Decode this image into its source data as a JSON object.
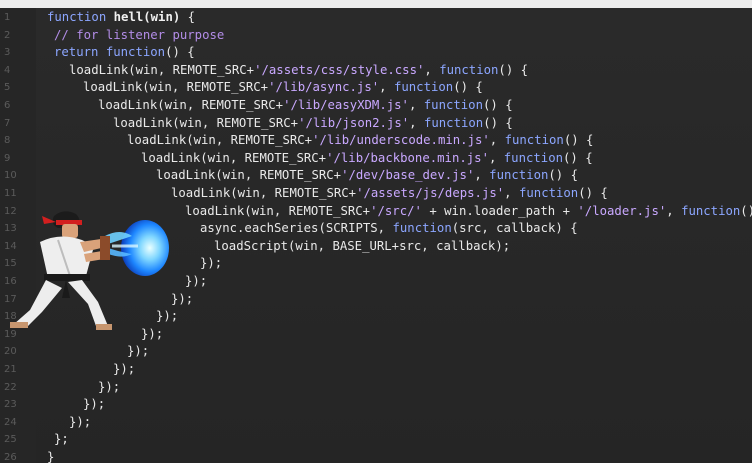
{
  "window": {
    "top_strip_color": "#ececec",
    "background_color": "#262626"
  },
  "colors": {
    "keyword": "#8ca6ff",
    "string": "#c9a8ff",
    "comment": "#b38de8",
    "plain": "#e9e9e9",
    "line_number": "#5b5b5b",
    "hadouken_blue": "#2ea7ff"
  },
  "sprite": {
    "icon": "street-fighter-ryu-hadouken-icon"
  },
  "code": {
    "lines": [
      {
        "number": "1",
        "indent": 11,
        "tokens": [
          {
            "t": "function",
            "c": "kw"
          },
          {
            "t": " ",
            "c": "plain"
          },
          {
            "t": "hell(win)",
            "c": "fnname"
          },
          {
            "t": " {",
            "c": "plain"
          }
        ]
      },
      {
        "number": "2",
        "indent": 18,
        "tokens": [
          {
            "t": "// for listener purpose",
            "c": "cmt"
          }
        ]
      },
      {
        "number": "3",
        "indent": 18,
        "tokens": [
          {
            "t": "return",
            "c": "kw"
          },
          {
            "t": " ",
            "c": "plain"
          },
          {
            "t": "function",
            "c": "kw"
          },
          {
            "t": "() {",
            "c": "plain"
          }
        ]
      },
      {
        "number": "4",
        "indent": 33,
        "tokens": [
          {
            "t": "loadLink(win, REMOTE_SRC+",
            "c": "plain"
          },
          {
            "t": "'/assets/css/style.css'",
            "c": "str"
          },
          {
            "t": ", ",
            "c": "plain"
          },
          {
            "t": "function",
            "c": "kw"
          },
          {
            "t": "() {",
            "c": "plain"
          }
        ]
      },
      {
        "number": "5",
        "indent": 47,
        "tokens": [
          {
            "t": "loadLink(win, REMOTE_SRC+",
            "c": "plain"
          },
          {
            "t": "'/lib/async.js'",
            "c": "str"
          },
          {
            "t": ", ",
            "c": "plain"
          },
          {
            "t": "function",
            "c": "kw"
          },
          {
            "t": "() {",
            "c": "plain"
          }
        ]
      },
      {
        "number": "6",
        "indent": 62,
        "tokens": [
          {
            "t": "loadLink(win, REMOTE_SRC+",
            "c": "plain"
          },
          {
            "t": "'/lib/easyXDM.js'",
            "c": "str"
          },
          {
            "t": ", ",
            "c": "plain"
          },
          {
            "t": "function",
            "c": "kw"
          },
          {
            "t": "() {",
            "c": "plain"
          }
        ]
      },
      {
        "number": "7",
        "indent": 77,
        "tokens": [
          {
            "t": "loadLink(win, REMOTE_SRC+",
            "c": "plain"
          },
          {
            "t": "'/lib/json2.js'",
            "c": "str"
          },
          {
            "t": ", ",
            "c": "plain"
          },
          {
            "t": "function",
            "c": "kw"
          },
          {
            "t": "() {",
            "c": "plain"
          }
        ]
      },
      {
        "number": "8",
        "indent": 91,
        "tokens": [
          {
            "t": "loadLink(win, REMOTE_SRC+",
            "c": "plain"
          },
          {
            "t": "'/lib/underscode.min.js'",
            "c": "str"
          },
          {
            "t": ", ",
            "c": "plain"
          },
          {
            "t": "function",
            "c": "kw"
          },
          {
            "t": "() {",
            "c": "plain"
          }
        ]
      },
      {
        "number": "9",
        "indent": 105,
        "tokens": [
          {
            "t": "loadLink(win, REMOTE_SRC+",
            "c": "plain"
          },
          {
            "t": "'/lib/backbone.min.js'",
            "c": "str"
          },
          {
            "t": ", ",
            "c": "plain"
          },
          {
            "t": "function",
            "c": "kw"
          },
          {
            "t": "() {",
            "c": "plain"
          }
        ]
      },
      {
        "number": "10",
        "indent": 120,
        "tokens": [
          {
            "t": "loadLink(win, REMOTE_SRC+",
            "c": "plain"
          },
          {
            "t": "'/dev/base_dev.js'",
            "c": "str"
          },
          {
            "t": ", ",
            "c": "plain"
          },
          {
            "t": "function",
            "c": "kw"
          },
          {
            "t": "() {",
            "c": "plain"
          }
        ]
      },
      {
        "number": "11",
        "indent": 135,
        "tokens": [
          {
            "t": "loadLink(win, REMOTE_SRC+",
            "c": "plain"
          },
          {
            "t": "'/assets/js/deps.js'",
            "c": "str"
          },
          {
            "t": ", ",
            "c": "plain"
          },
          {
            "t": "function",
            "c": "kw"
          },
          {
            "t": "() {",
            "c": "plain"
          }
        ]
      },
      {
        "number": "12",
        "indent": 149,
        "tokens": [
          {
            "t": "loadLink(win, REMOTE_SRC+",
            "c": "plain"
          },
          {
            "t": "'/src/'",
            "c": "str"
          },
          {
            "t": " + win.loader_path + ",
            "c": "plain"
          },
          {
            "t": "'/loader.js'",
            "c": "str"
          },
          {
            "t": ", ",
            "c": "plain"
          },
          {
            "t": "function",
            "c": "kw"
          },
          {
            "t": "()",
            "c": "plain"
          }
        ]
      },
      {
        "number": "13",
        "indent": 164,
        "tokens": [
          {
            "t": "async.eachSeries(SCRIPTS, ",
            "c": "plain"
          },
          {
            "t": "function",
            "c": "kw"
          },
          {
            "t": "(src, callback) {",
            "c": "plain"
          }
        ]
      },
      {
        "number": "14",
        "indent": 178,
        "tokens": [
          {
            "t": "loadScript(win, BASE_URL+src, callback);",
            "c": "plain"
          }
        ]
      },
      {
        "number": "15",
        "indent": 164,
        "tokens": [
          {
            "t": "});",
            "c": "plain"
          }
        ]
      },
      {
        "number": "16",
        "indent": 149,
        "tokens": [
          {
            "t": "});",
            "c": "plain"
          }
        ]
      },
      {
        "number": "17",
        "indent": 135,
        "tokens": [
          {
            "t": "});",
            "c": "plain"
          }
        ]
      },
      {
        "number": "18",
        "indent": 120,
        "tokens": [
          {
            "t": "});",
            "c": "plain"
          }
        ]
      },
      {
        "number": "19",
        "indent": 105,
        "tokens": [
          {
            "t": "});",
            "c": "plain"
          }
        ]
      },
      {
        "number": "20",
        "indent": 91,
        "tokens": [
          {
            "t": "});",
            "c": "plain"
          }
        ]
      },
      {
        "number": "21",
        "indent": 77,
        "tokens": [
          {
            "t": "});",
            "c": "plain"
          }
        ]
      },
      {
        "number": "22",
        "indent": 62,
        "tokens": [
          {
            "t": "});",
            "c": "plain"
          }
        ]
      },
      {
        "number": "23",
        "indent": 47,
        "tokens": [
          {
            "t": "});",
            "c": "plain"
          }
        ]
      },
      {
        "number": "24",
        "indent": 33,
        "tokens": [
          {
            "t": "});",
            "c": "plain"
          }
        ]
      },
      {
        "number": "25",
        "indent": 18,
        "tokens": [
          {
            "t": "};",
            "c": "plain"
          }
        ]
      },
      {
        "number": "26",
        "indent": 11,
        "tokens": [
          {
            "t": "}",
            "c": "plain"
          }
        ]
      }
    ]
  }
}
